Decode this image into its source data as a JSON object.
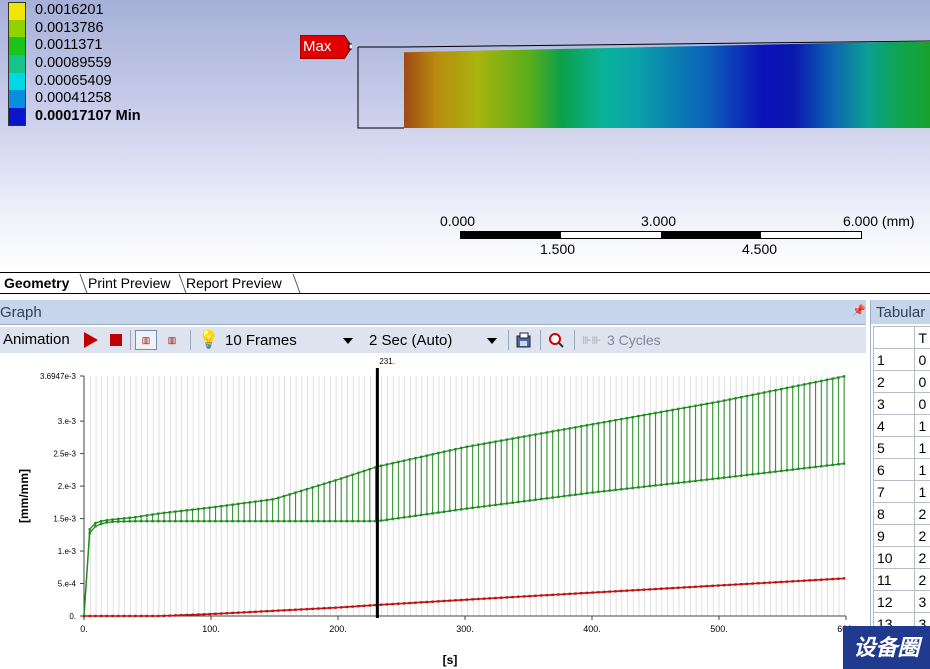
{
  "legend": {
    "items": [
      {
        "value": "0.0016201",
        "color": "#f2e600"
      },
      {
        "value": "0.0013786",
        "color": "#8ed200"
      },
      {
        "value": "0.0011371",
        "color": "#1cc41c"
      },
      {
        "value": "0.00089559",
        "color": "#14c48a"
      },
      {
        "value": "0.00065409",
        "color": "#00d8e4"
      },
      {
        "value": "0.00041258",
        "color": "#0a8ee0"
      }
    ],
    "min": {
      "value": "0.00017107 Min",
      "color": "#0a14c8"
    }
  },
  "geometry": {
    "max_label": "Max"
  },
  "scale": {
    "top_labels": [
      "0.000",
      "3.000",
      "6.000 (mm)"
    ],
    "bottom_labels": [
      "1.500",
      "4.500"
    ]
  },
  "tabs": [
    {
      "label": "Geometry",
      "active": true
    },
    {
      "label": "Print Preview"
    },
    {
      "label": "Report Preview"
    }
  ],
  "graph_panel": {
    "title": "Graph",
    "pin_icon": "pin-icon",
    "toolbar": {
      "animation_label": "Animation",
      "frames_btn1": "▥",
      "frames_btn2": "▥",
      "frames_value": "10 Frames",
      "time_value": "2 Sec (Auto)",
      "cycles_label": "3 Cycles"
    }
  },
  "tabular_panel": {
    "title": "Tabular",
    "header_cell": "T",
    "rows": [
      {
        "n": "1",
        "v": "0"
      },
      {
        "n": "2",
        "v": "0"
      },
      {
        "n": "3",
        "v": "0"
      },
      {
        "n": "4",
        "v": "1"
      },
      {
        "n": "5",
        "v": "1"
      },
      {
        "n": "6",
        "v": "1"
      },
      {
        "n": "7",
        "v": "1"
      },
      {
        "n": "8",
        "v": "2"
      },
      {
        "n": "9",
        "v": "2"
      },
      {
        "n": "10",
        "v": "2"
      },
      {
        "n": "11",
        "v": "2"
      },
      {
        "n": "12",
        "v": "3"
      },
      {
        "n": "13",
        "v": "3"
      }
    ]
  },
  "watermark": "设备圈",
  "chart_data": {
    "type": "line",
    "xlabel": "[s]",
    "ylabel": "[mm/mm]",
    "xlim": [
      0,
      600
    ],
    "ylim": [
      0,
      0.0036947
    ],
    "x_ticks": [
      "0.",
      "100.",
      "200.",
      "300.",
      "400.",
      "500.",
      "600."
    ],
    "y_ticks": [
      {
        "value": 0,
        "label": "0."
      },
      {
        "value": 0.0005,
        "label": "5.e-4"
      },
      {
        "value": 0.001,
        "label": "1.e-3"
      },
      {
        "value": 0.0015,
        "label": "1.5e-3"
      },
      {
        "value": 0.002,
        "label": "2.e-3"
      },
      {
        "value": 0.0025,
        "label": "2.5e-3"
      },
      {
        "value": 0.003,
        "label": "3.e-3"
      },
      {
        "value": 0.0036947,
        "label": "3.6947e-3"
      }
    ],
    "cursor": {
      "x": 231,
      "label": "231."
    },
    "series": [
      {
        "role": "upper",
        "color": "#1e8c1e",
        "x": [
          0,
          2,
          5,
          10,
          20,
          40,
          60,
          100,
          150,
          200,
          231,
          300,
          400,
          500,
          600
        ],
        "y": [
          0,
          0.00125,
          0.00135,
          0.00145,
          0.00148,
          0.00152,
          0.00158,
          0.00167,
          0.0018,
          0.0021,
          0.0023,
          0.0026,
          0.00295,
          0.0033,
          0.0036947
        ]
      },
      {
        "role": "lower",
        "color": "#1e8c1e",
        "x": [
          0,
          2,
          5,
          10,
          20,
          40,
          60,
          100,
          150,
          200,
          231,
          300,
          400,
          500,
          600
        ],
        "y": [
          0,
          0.00115,
          0.0013,
          0.0014,
          0.00145,
          0.00146,
          0.00146,
          0.00146,
          0.00146,
          0.00146,
          0.00146,
          0.00165,
          0.0019,
          0.00212,
          0.00235
        ]
      },
      {
        "role": "red",
        "color": "#c01010",
        "x": [
          0,
          60,
          100,
          150,
          200,
          231,
          300,
          400,
          500,
          600
        ],
        "y": [
          0,
          0.0,
          3e-05,
          8e-05,
          0.00013,
          0.00017,
          0.00025,
          0.00036,
          0.00047,
          0.00058
        ]
      }
    ]
  }
}
